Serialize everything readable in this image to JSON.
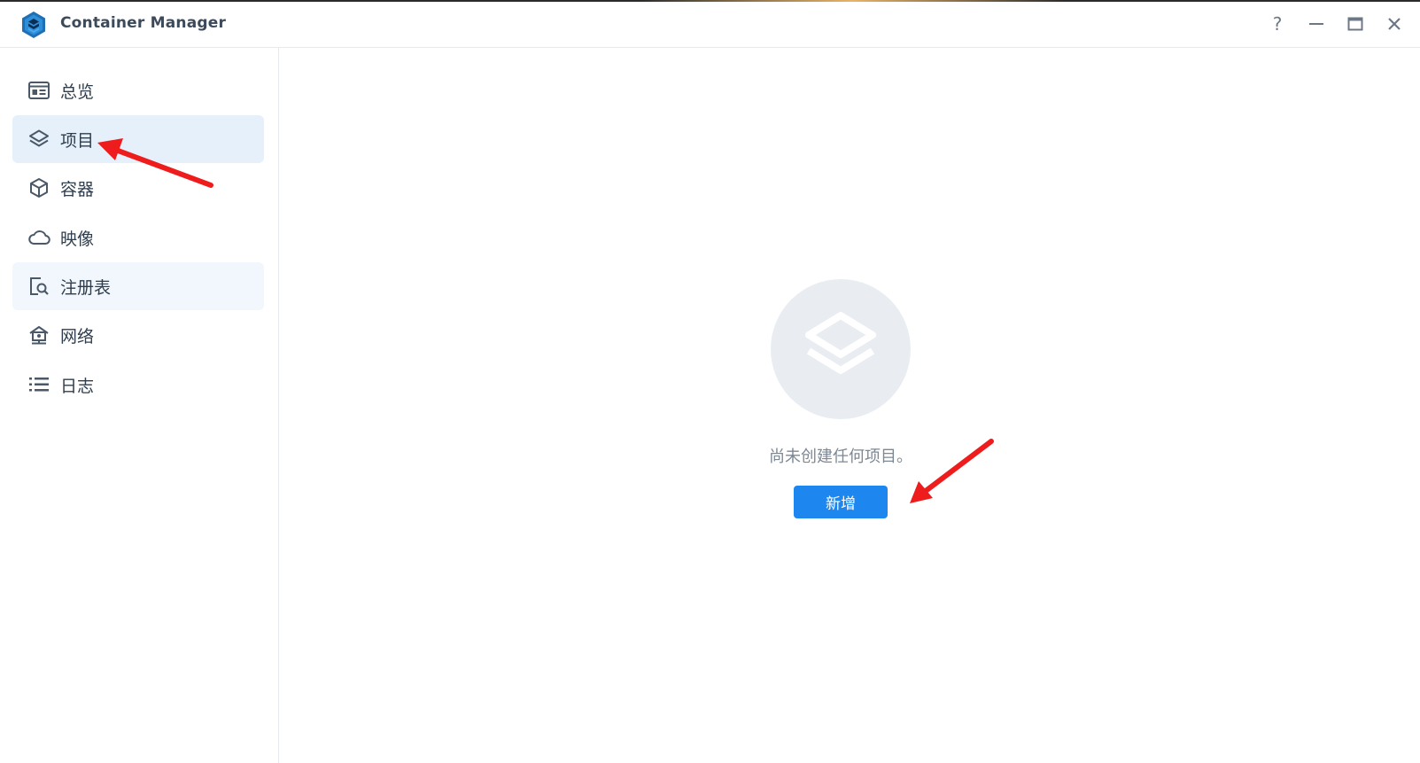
{
  "window": {
    "title": "Container Manager",
    "controls": {
      "help": "?",
      "minimize": "—",
      "maximize": "▭",
      "close": "✕"
    }
  },
  "sidebar": {
    "items": [
      {
        "id": "overview",
        "label": "总览",
        "icon": "overview-icon",
        "state": "normal"
      },
      {
        "id": "project",
        "label": "项目",
        "icon": "layers-icon",
        "state": "active"
      },
      {
        "id": "container",
        "label": "容器",
        "icon": "cube-icon",
        "state": "normal"
      },
      {
        "id": "image",
        "label": "映像",
        "icon": "cloud-icon",
        "state": "normal"
      },
      {
        "id": "registry",
        "label": "注册表",
        "icon": "registry-search-icon",
        "state": "hover"
      },
      {
        "id": "network",
        "label": "网络",
        "icon": "network-home-icon",
        "state": "normal"
      },
      {
        "id": "log",
        "label": "日志",
        "icon": "list-icon",
        "state": "normal"
      }
    ]
  },
  "main": {
    "empty_message": "尚未创建任何项目。",
    "add_button_label": "新增",
    "empty_icon": "layers-icon"
  },
  "colors": {
    "accent": "#1d87ef",
    "active_bg": "#e5f0fb",
    "hover_bg": "#f2f7fd",
    "annotation_arrow": "#ee1c1c"
  }
}
